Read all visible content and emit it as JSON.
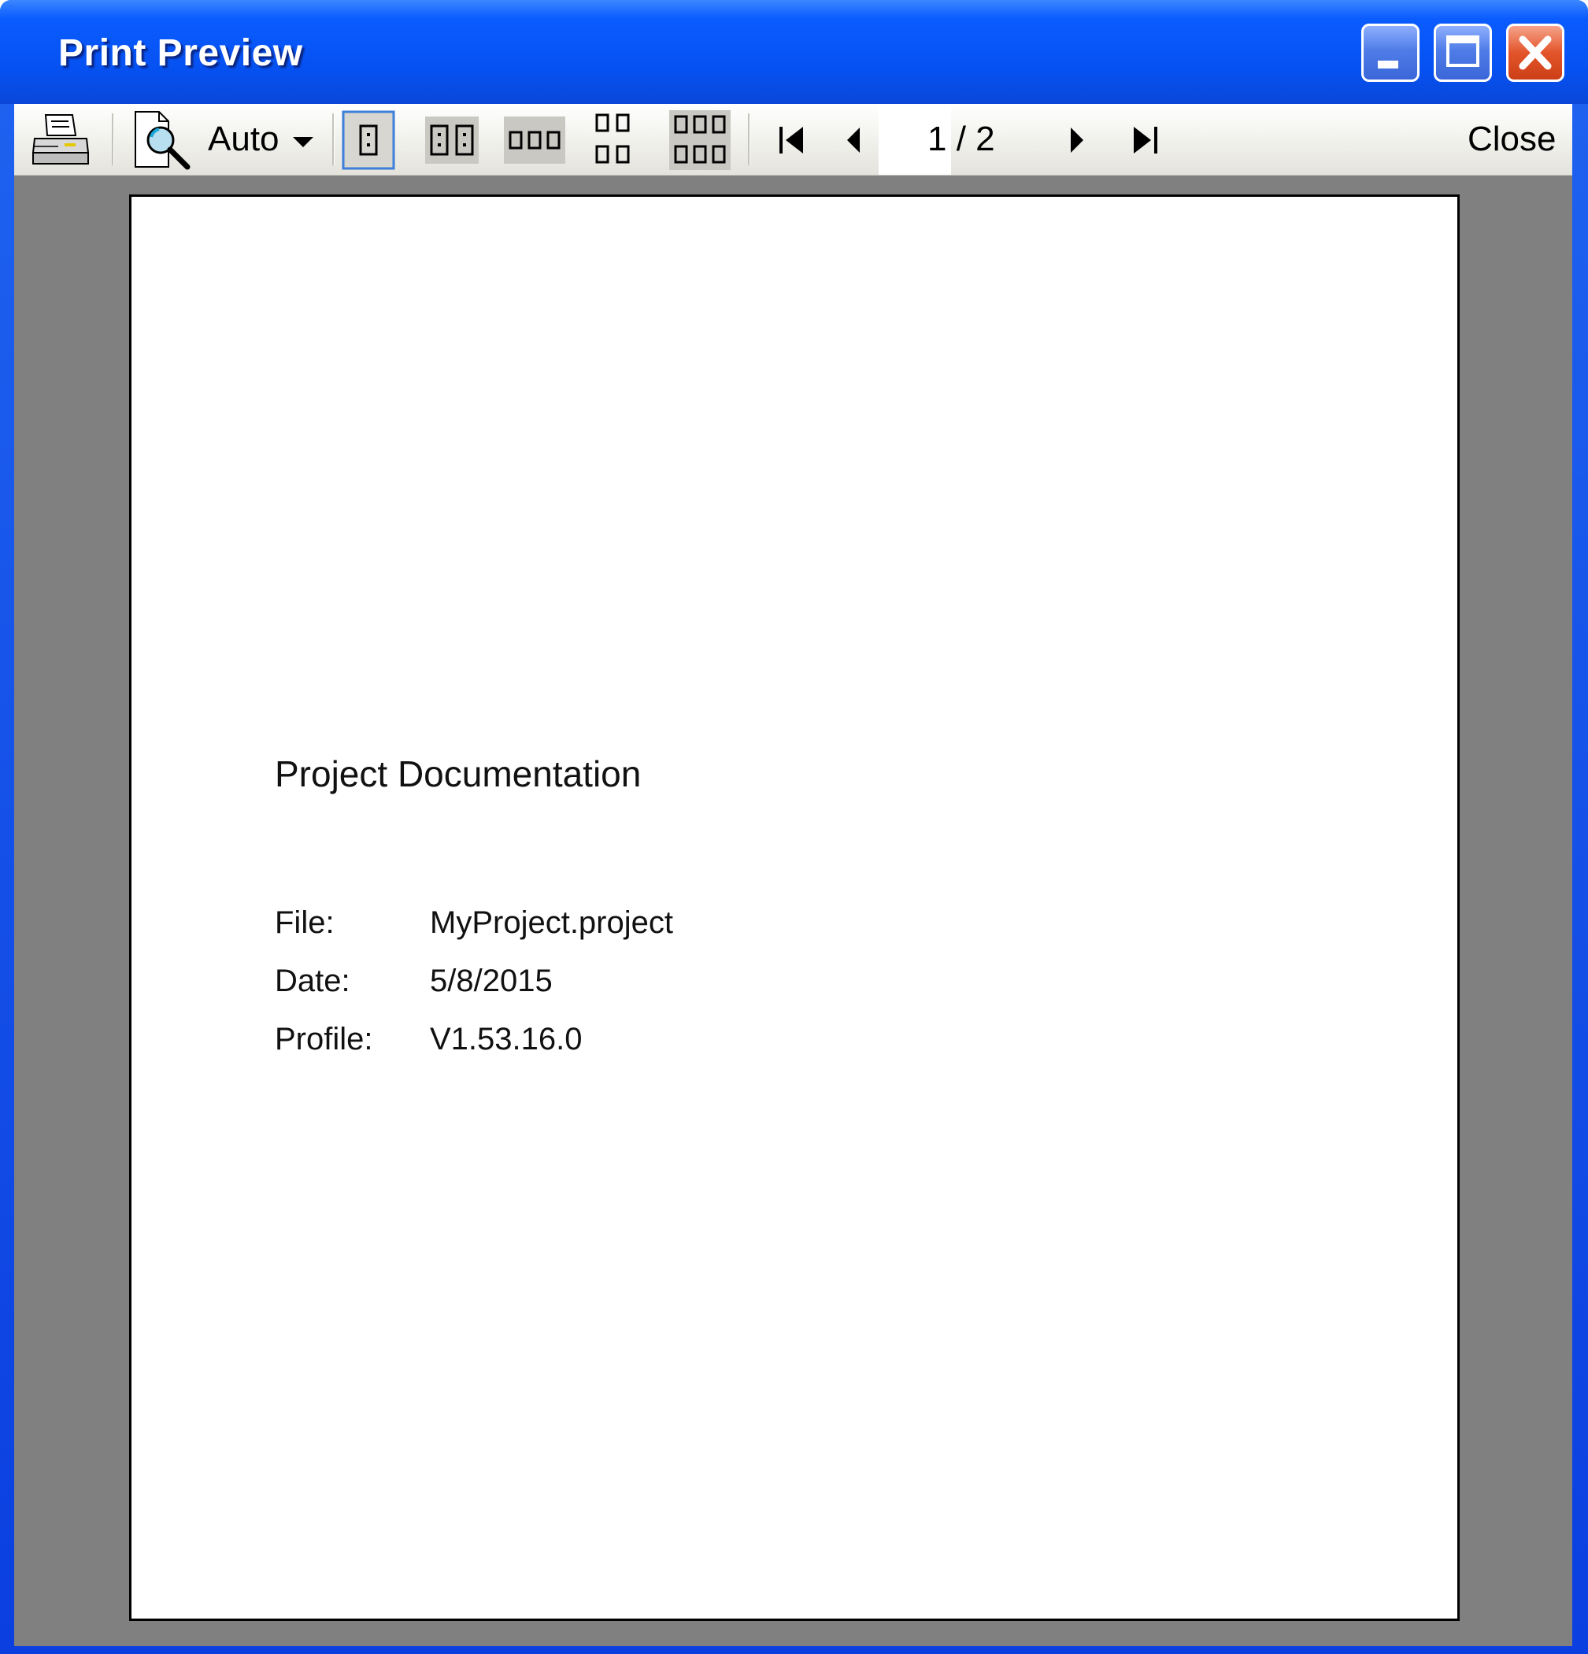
{
  "window": {
    "title": "Print Preview",
    "controls": [
      "minimize",
      "maximize",
      "close"
    ]
  },
  "toolbar": {
    "print_icon": "printer-icon",
    "zoom_icon": "magnifier-page-icon",
    "zoom_value": "Auto",
    "layouts": [
      "one-page",
      "two-pages",
      "three-pages",
      "four-pages",
      "six-pages"
    ],
    "selected_layout": "one-page",
    "current_page": "1",
    "page_total_separator": "/ 2",
    "close_label": "Close"
  },
  "document": {
    "title": "Project Documentation",
    "rows": [
      {
        "label": "File:",
        "value": "MyProject.project"
      },
      {
        "label": "Date:",
        "value": "5/8/2015"
      },
      {
        "label": "Profile:",
        "value": "V1.53.16.0"
      }
    ]
  },
  "colors": {
    "titlebar": "#0650f0",
    "close_button": "#e3542a",
    "viewport_background": "#808080",
    "selected_layout_border": "#3d7fd9"
  }
}
